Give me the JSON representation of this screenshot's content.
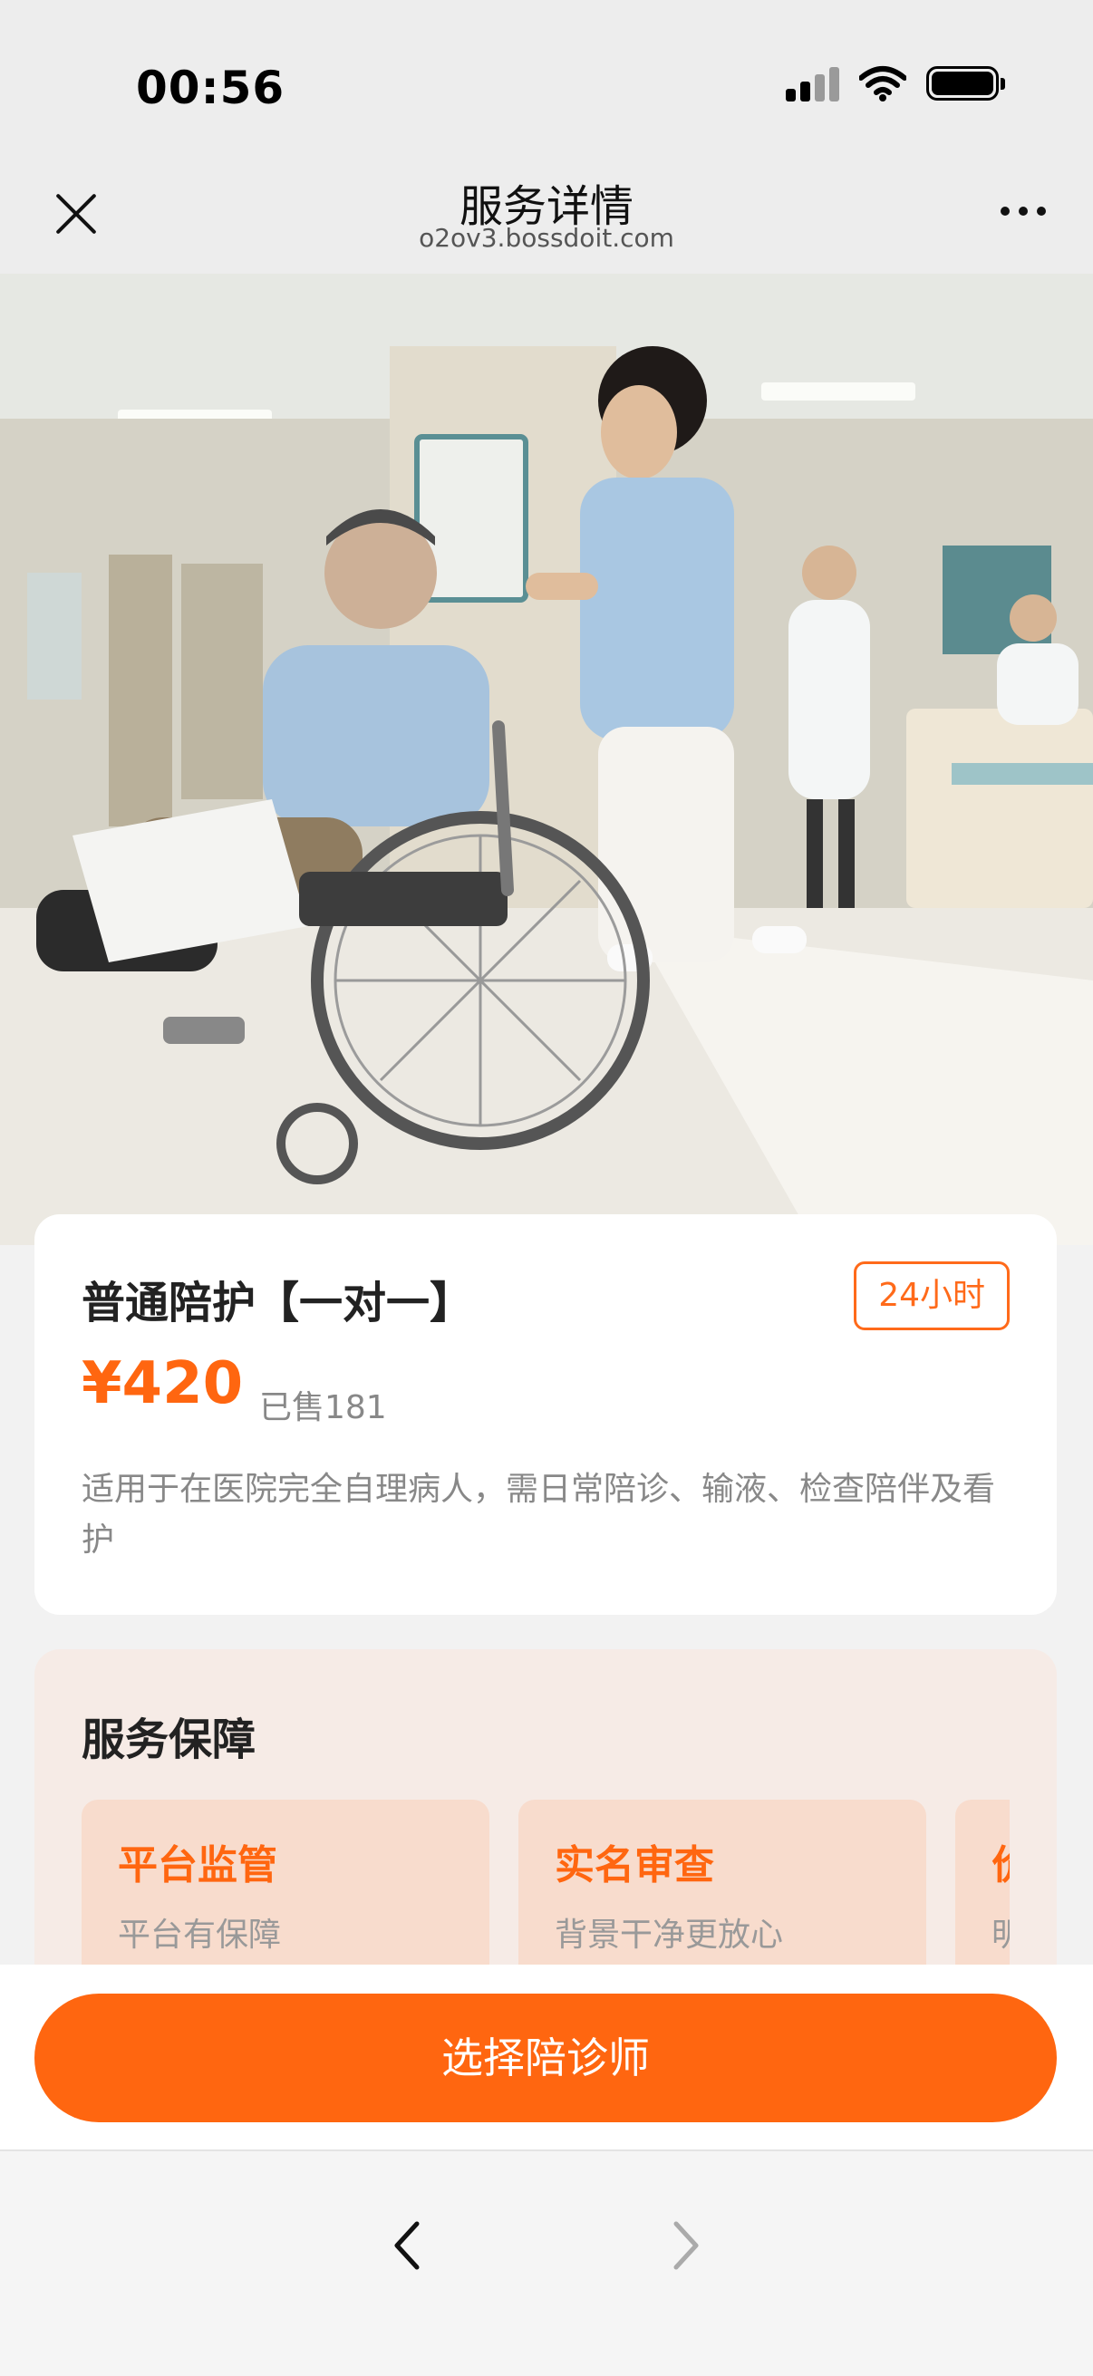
{
  "status_bar": {
    "time": "00:56"
  },
  "nav": {
    "title": "服务详情",
    "subtitle": "o2ov3.bossdoit.com"
  },
  "hero": {
    "slide_count": 1,
    "active_slide": 1
  },
  "product": {
    "name": "普通陪护【一对一】",
    "tag": "24小时",
    "price": "¥420",
    "sold": "已售181",
    "description": "适用于在医院完全自理病人，需日常陪诊、输液、检查陪伴及看护"
  },
  "guarantee": {
    "title": "服务保障",
    "items": [
      {
        "title": "平台监管",
        "subtitle": "平台有保障"
      },
      {
        "title": "实名审查",
        "subtitle": "背景干净更放心"
      },
      {
        "title": "价",
        "subtitle": "明"
      }
    ]
  },
  "action": {
    "select_label": "选择陪诊师"
  },
  "colors": {
    "accent": "#ff6610",
    "accent_light": "#f8dccd",
    "card_bg": "#f6ebe6"
  }
}
